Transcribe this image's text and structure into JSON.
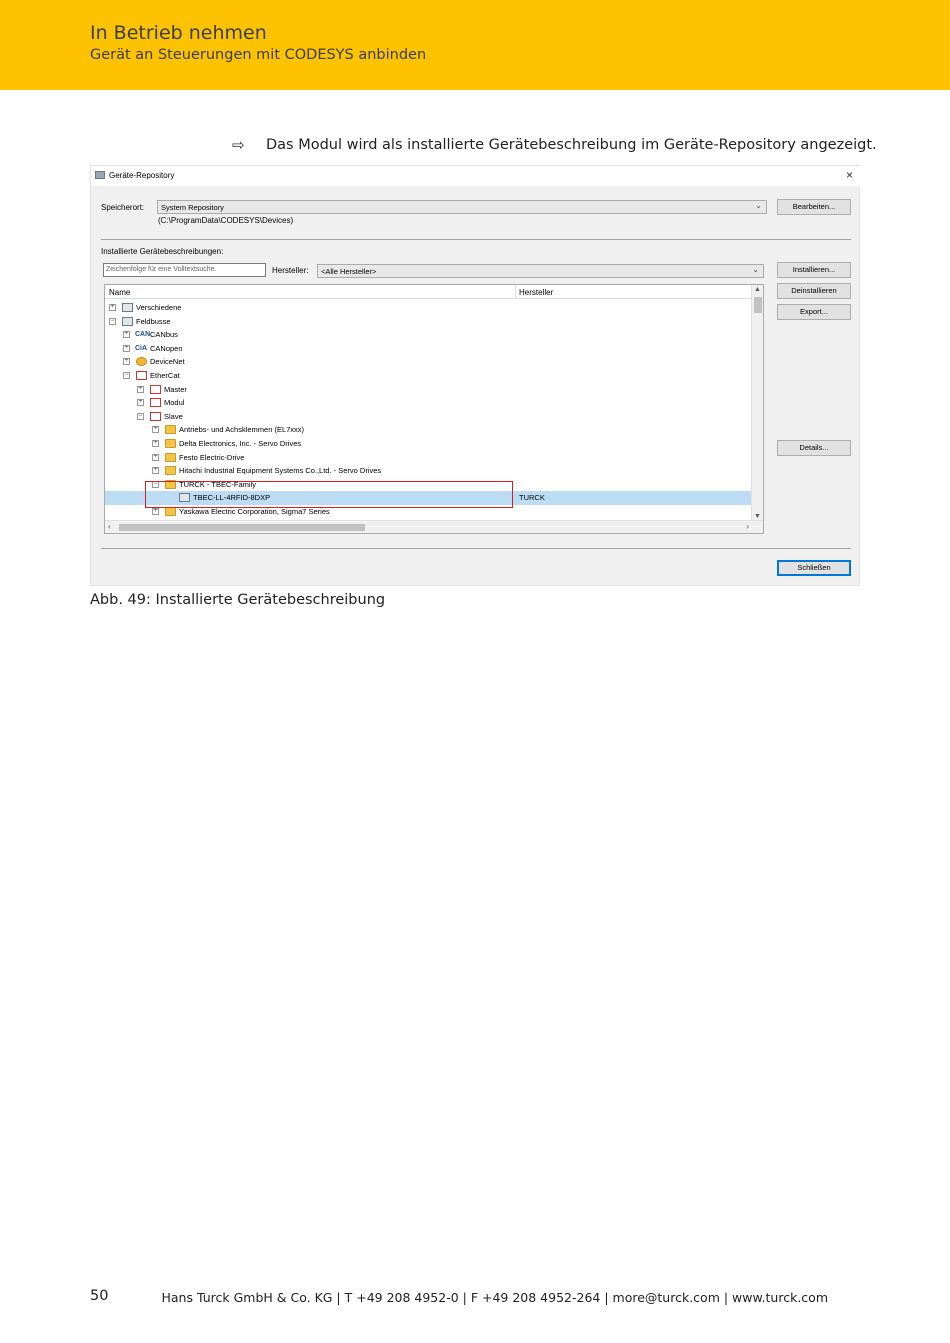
{
  "header": {
    "title": "In Betrieb nehmen",
    "subtitle": "Gerät an Steuerungen mit CODESYS anbinden"
  },
  "result_line": {
    "arrow": "⇨",
    "text": "Das Modul wird als installierte Gerätebeschreibung im Geräte-Repository angezeigt."
  },
  "dialog": {
    "title": "Geräte-Repository",
    "close": "×",
    "location_label": "Speicherort:",
    "location_value": "System Repository",
    "location_path": "(C:\\ProgramData\\CODESYS\\Devices)",
    "edit_button": "Bearbeiten...",
    "installed_label": "Installierte Gerätebeschreibungen:",
    "search_placeholder": "Zeichenfolge für eine Volltextsuche.",
    "manufacturer_label": "Hersteller:",
    "manufacturer_value": "<Alle Hersteller>",
    "buttons": {
      "install": "Installieren...",
      "uninstall": "Deinstallieren",
      "export": "Export...",
      "details": "Details...",
      "close": "Schließen"
    },
    "tree": {
      "col_name": "Name",
      "col_manufacturer": "Hersteller",
      "rows": [
        {
          "label": "Verschiedene",
          "exp": "+"
        },
        {
          "label": "Feldbusse",
          "exp": "−"
        },
        {
          "label": "CANbus",
          "exp": "+",
          "icon_text": "CAN"
        },
        {
          "label": "CANopen",
          "exp": "+",
          "icon_text": "CiA"
        },
        {
          "label": "DeviceNet",
          "exp": "+"
        },
        {
          "label": "EtherCat",
          "exp": "−"
        },
        {
          "label": "Master",
          "exp": "+"
        },
        {
          "label": "Modul",
          "exp": "+"
        },
        {
          "label": "Slave",
          "exp": "−"
        },
        {
          "label": "Antriebs- und Achsklemmen (EL7xxx)",
          "exp": "+"
        },
        {
          "label": "Delta Electronics, Inc. - Servo Drives",
          "exp": "+"
        },
        {
          "label": "Festo Electric-Drive",
          "exp": "+"
        },
        {
          "label": "Hitachi Industrial Equipment Systems Co.,Ltd. - Servo Drives",
          "exp": "+"
        },
        {
          "label": "TURCK - TBEC-Family",
          "exp": "−"
        },
        {
          "label": "TBEC-LL-4RFID-8DXP",
          "manufacturer": "TURCK"
        },
        {
          "label": "Yaskawa Electric Corporation, Sigma7 Series",
          "exp": "+"
        }
      ]
    }
  },
  "caption": "Abb. 49: Installierte Gerätebeschreibung",
  "footer": {
    "page_number": "50",
    "address": "Hans Turck GmbH & Co. KG | T +49 208 4952-0 | F +49 208 4952-264 | more@turck.com | www.turck.com"
  }
}
